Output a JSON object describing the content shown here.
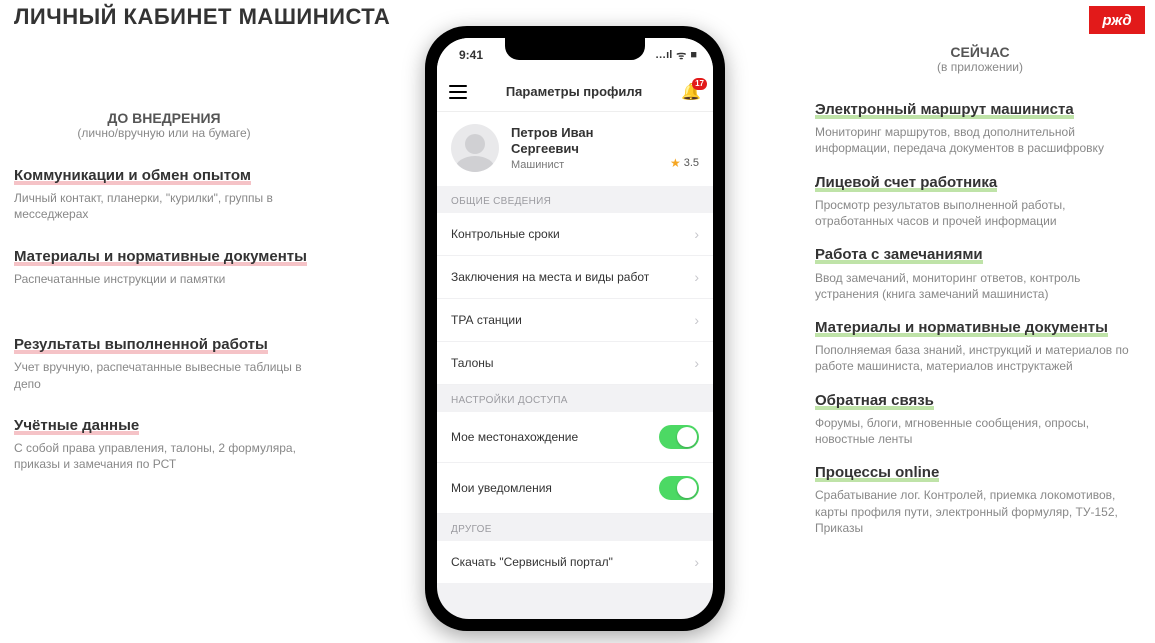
{
  "page_title": "ЛИЧНЫЙ КАБИНЕТ МАШИНИСТА",
  "logo_text": "ржд",
  "left": {
    "header_title": "ДО ВНЕДРЕНИЯ",
    "header_sub": "(лично/вручную или на бумаге)",
    "blocks": [
      {
        "title": "Коммуникации и обмен опытом",
        "desc": "Личный контакт, планерки, \"курилки\", группы в месседжерах"
      },
      {
        "title": "Материалы и нормативные документы",
        "desc": "Распечатанные инструкции и памятки"
      },
      {
        "title": "Результаты выполненной работы",
        "desc": "Учет вручную, распечатанные вывесные таблицы в депо"
      },
      {
        "title": "Учётные данные",
        "desc": "С собой права управления, талоны, 2 формуляра, приказы и замечания по РСТ"
      }
    ]
  },
  "right": {
    "header_title": "СЕЙЧАС",
    "header_sub": "(в приложении)",
    "blocks": [
      {
        "title": "Электронный маршрут машиниста",
        "desc": "Мониторинг маршрутов, ввод дополнительной информации, передача документов в расшифровку"
      },
      {
        "title": "Лицевой счет работника",
        "desc": "Просмотр результатов выполненной работы, отработанных часов и прочей информации"
      },
      {
        "title": "Работа с замечаниями",
        "desc": "Ввод замечаний, мониторинг ответов, контроль устранения (книга замечаний машиниста)"
      },
      {
        "title": "Материалы и нормативные документы",
        "desc": "Пополняемая база знаний, инструкций и материалов по работе машиниста, материалов инструктажей"
      },
      {
        "title": "Обратная связь",
        "desc": "Форумы, блоги, мгновенные сообщения, опросы, новостные ленты"
      },
      {
        "title": "Процессы online",
        "desc": "Срабатывание лог. Контролей, приемка локомотивов, карты профиля пути, электронный формуляр, ТУ-152, Приказы"
      }
    ]
  },
  "phone": {
    "time": "9:41",
    "signal": "…ıl",
    "wifi": "ᯤ",
    "battery": "■",
    "screen_title": "Параметры профиля",
    "notif_count": "17",
    "profile": {
      "name_line1": "Петров Иван",
      "name_line2": "Сергеевич",
      "role": "Машинист",
      "rating": "3.5"
    },
    "section1_label": "ОБЩИЕ СВЕДЕНИЯ",
    "section1": [
      "Контрольные сроки",
      "Заключения на места и виды работ",
      "ТРА станции",
      "Талоны"
    ],
    "section2_label": "НАСТРОЙКИ ДОСТУПА",
    "section2": [
      "Мое местонахождение",
      "Мои уведомления"
    ],
    "section3_label": "ДРУГОЕ",
    "section3": [
      "Скачать \"Сервисный портал\""
    ]
  }
}
